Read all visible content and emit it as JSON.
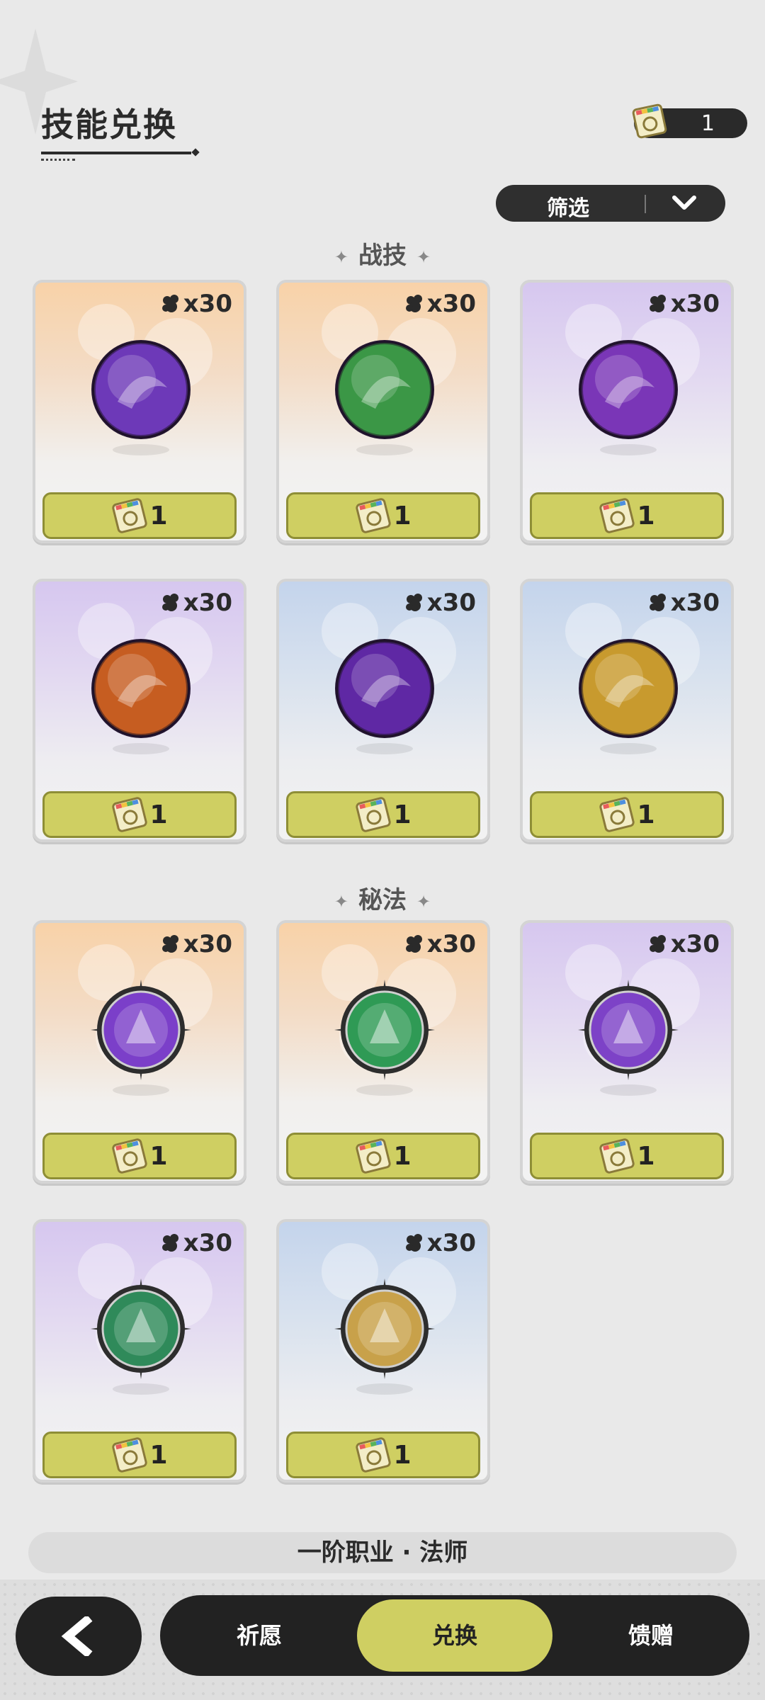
{
  "header": {
    "title": "技能兑换",
    "currency_amount": "1",
    "currency_icon": "exchange-ticket-icon"
  },
  "filter": {
    "label": "筛选",
    "icon": "chevron-down-icon"
  },
  "sections": [
    {
      "name": "战技",
      "cards": [
        {
          "count": "x30",
          "price": "1",
          "rarity": "orange",
          "icon": "purple-vortex-orb-icon",
          "color": "#7a3fd0"
        },
        {
          "count": "x30",
          "price": "1",
          "rarity": "orange",
          "icon": "green-tree-stump-orb-icon",
          "color": "#3fae4a"
        },
        {
          "count": "x30",
          "price": "1",
          "rarity": "purple",
          "icon": "purple-diamond-flame-orb-icon",
          "color": "#8a3ccf"
        },
        {
          "count": "x30",
          "price": "1",
          "rarity": "purple",
          "icon": "fire-wolf-orb-icon",
          "color": "#e36a1e"
        },
        {
          "count": "x30",
          "price": "1",
          "rarity": "blue",
          "icon": "purple-eye-orb-icon",
          "color": "#6a2bb8"
        },
        {
          "count": "x30",
          "price": "1",
          "rarity": "blue",
          "icon": "golden-sparkle-orb-icon",
          "color": "#e5b22e"
        }
      ]
    },
    {
      "name": "秘法",
      "cards": [
        {
          "count": "x30",
          "price": "1",
          "rarity": "orange",
          "icon": "purple-fist-rune-icon",
          "color": "#7b3fc9"
        },
        {
          "count": "x30",
          "price": "1",
          "rarity": "orange",
          "icon": "green-winged-star-rune-icon",
          "color": "#2f9a55"
        },
        {
          "count": "x30",
          "price": "1",
          "rarity": "purple",
          "icon": "purple-flame-seal-rune-icon",
          "color": "#7d42c7"
        },
        {
          "count": "x30",
          "price": "1",
          "rarity": "purple",
          "icon": "green-fist-clock-rune-icon",
          "color": "#2f8a5a"
        },
        {
          "count": "x30",
          "price": "1",
          "rarity": "blue",
          "icon": "golden-arrow-heal-rune-icon",
          "color": "#c8a14a"
        }
      ]
    }
  ],
  "class_bar": "一阶职业 · 法师",
  "nav": {
    "back_icon": "back-arrow-icon",
    "tabs": [
      {
        "label": "祈愿",
        "active": false
      },
      {
        "label": "兑换",
        "active": true
      },
      {
        "label": "馈赠",
        "active": false
      }
    ]
  }
}
